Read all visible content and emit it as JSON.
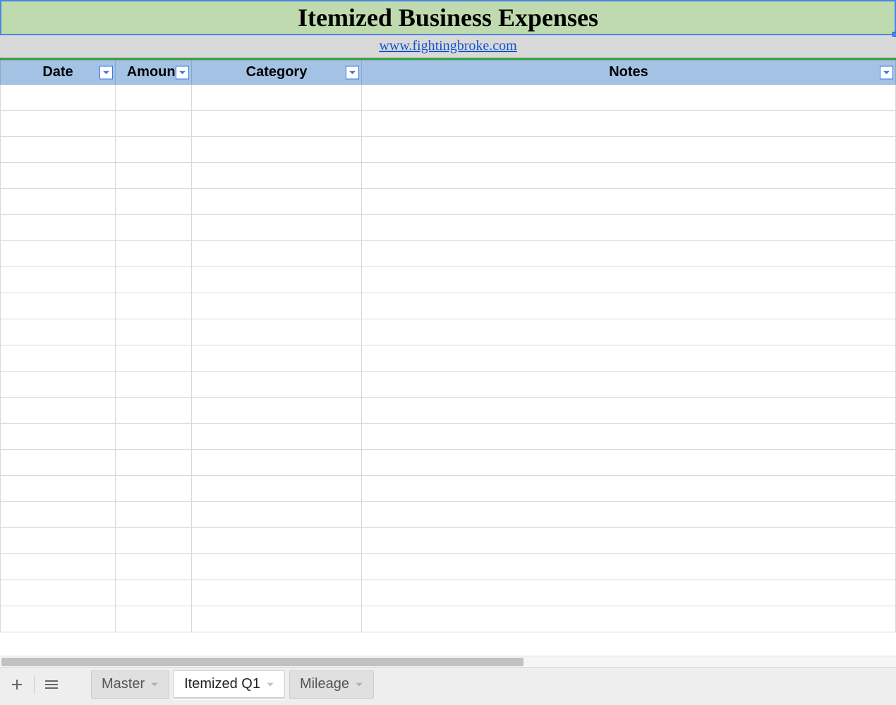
{
  "title": "Itemized Business Expenses",
  "link_text": "www.fightingbroke.com",
  "columns": {
    "date": "Date",
    "amount": "Amount",
    "category": "Category",
    "notes": "Notes"
  },
  "rows": 21,
  "tabs": [
    {
      "label": "Master",
      "active": false
    },
    {
      "label": "Itemized Q1",
      "active": true
    },
    {
      "label": "Mileage",
      "active": false
    }
  ],
  "colors": {
    "title_bg": "#bedaae",
    "header_bg": "#a4c2e3",
    "selection_border": "#4a86e8",
    "link": "#1155cc"
  }
}
